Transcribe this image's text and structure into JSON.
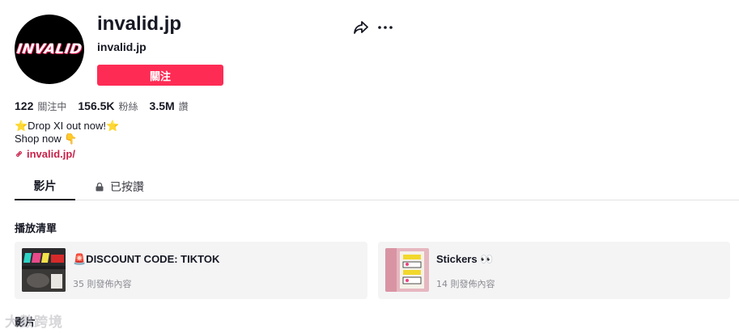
{
  "profile": {
    "avatar_text": "INVALID",
    "title": "invalid.jp",
    "username": "invalid.jp",
    "follow_label": "關注"
  },
  "icons": {
    "share": "share-arrow-icon",
    "more": "more-dots-icon",
    "link": "link-icon",
    "lock": "lock-icon"
  },
  "stats": [
    {
      "value": "122",
      "label": "關注中"
    },
    {
      "value": "156.5K",
      "label": "粉絲"
    },
    {
      "value": "3.5M",
      "label": "讚"
    }
  ],
  "bio": {
    "line1": "⭐Drop XI out now!⭐",
    "line2": "Shop now 👇"
  },
  "link": "invalid.jp/",
  "tabs": [
    {
      "label": "影片"
    },
    {
      "label": "已按讚"
    }
  ],
  "playlists_title": "播放清單",
  "playlists": [
    {
      "title": "🚨DISCOUNT CODE: TIKTOK",
      "count": "35 則發佈內容"
    },
    {
      "title": "Stickers 👀",
      "count": "14 則發佈內容"
    }
  ],
  "videos_title": "影片",
  "watermark": "大數跨境",
  "colors": {
    "accent": "#fe2c55",
    "link": "#c9214a",
    "text": "#161823",
    "muted": "#8a8b91",
    "card_bg": "#f4f4f5"
  }
}
